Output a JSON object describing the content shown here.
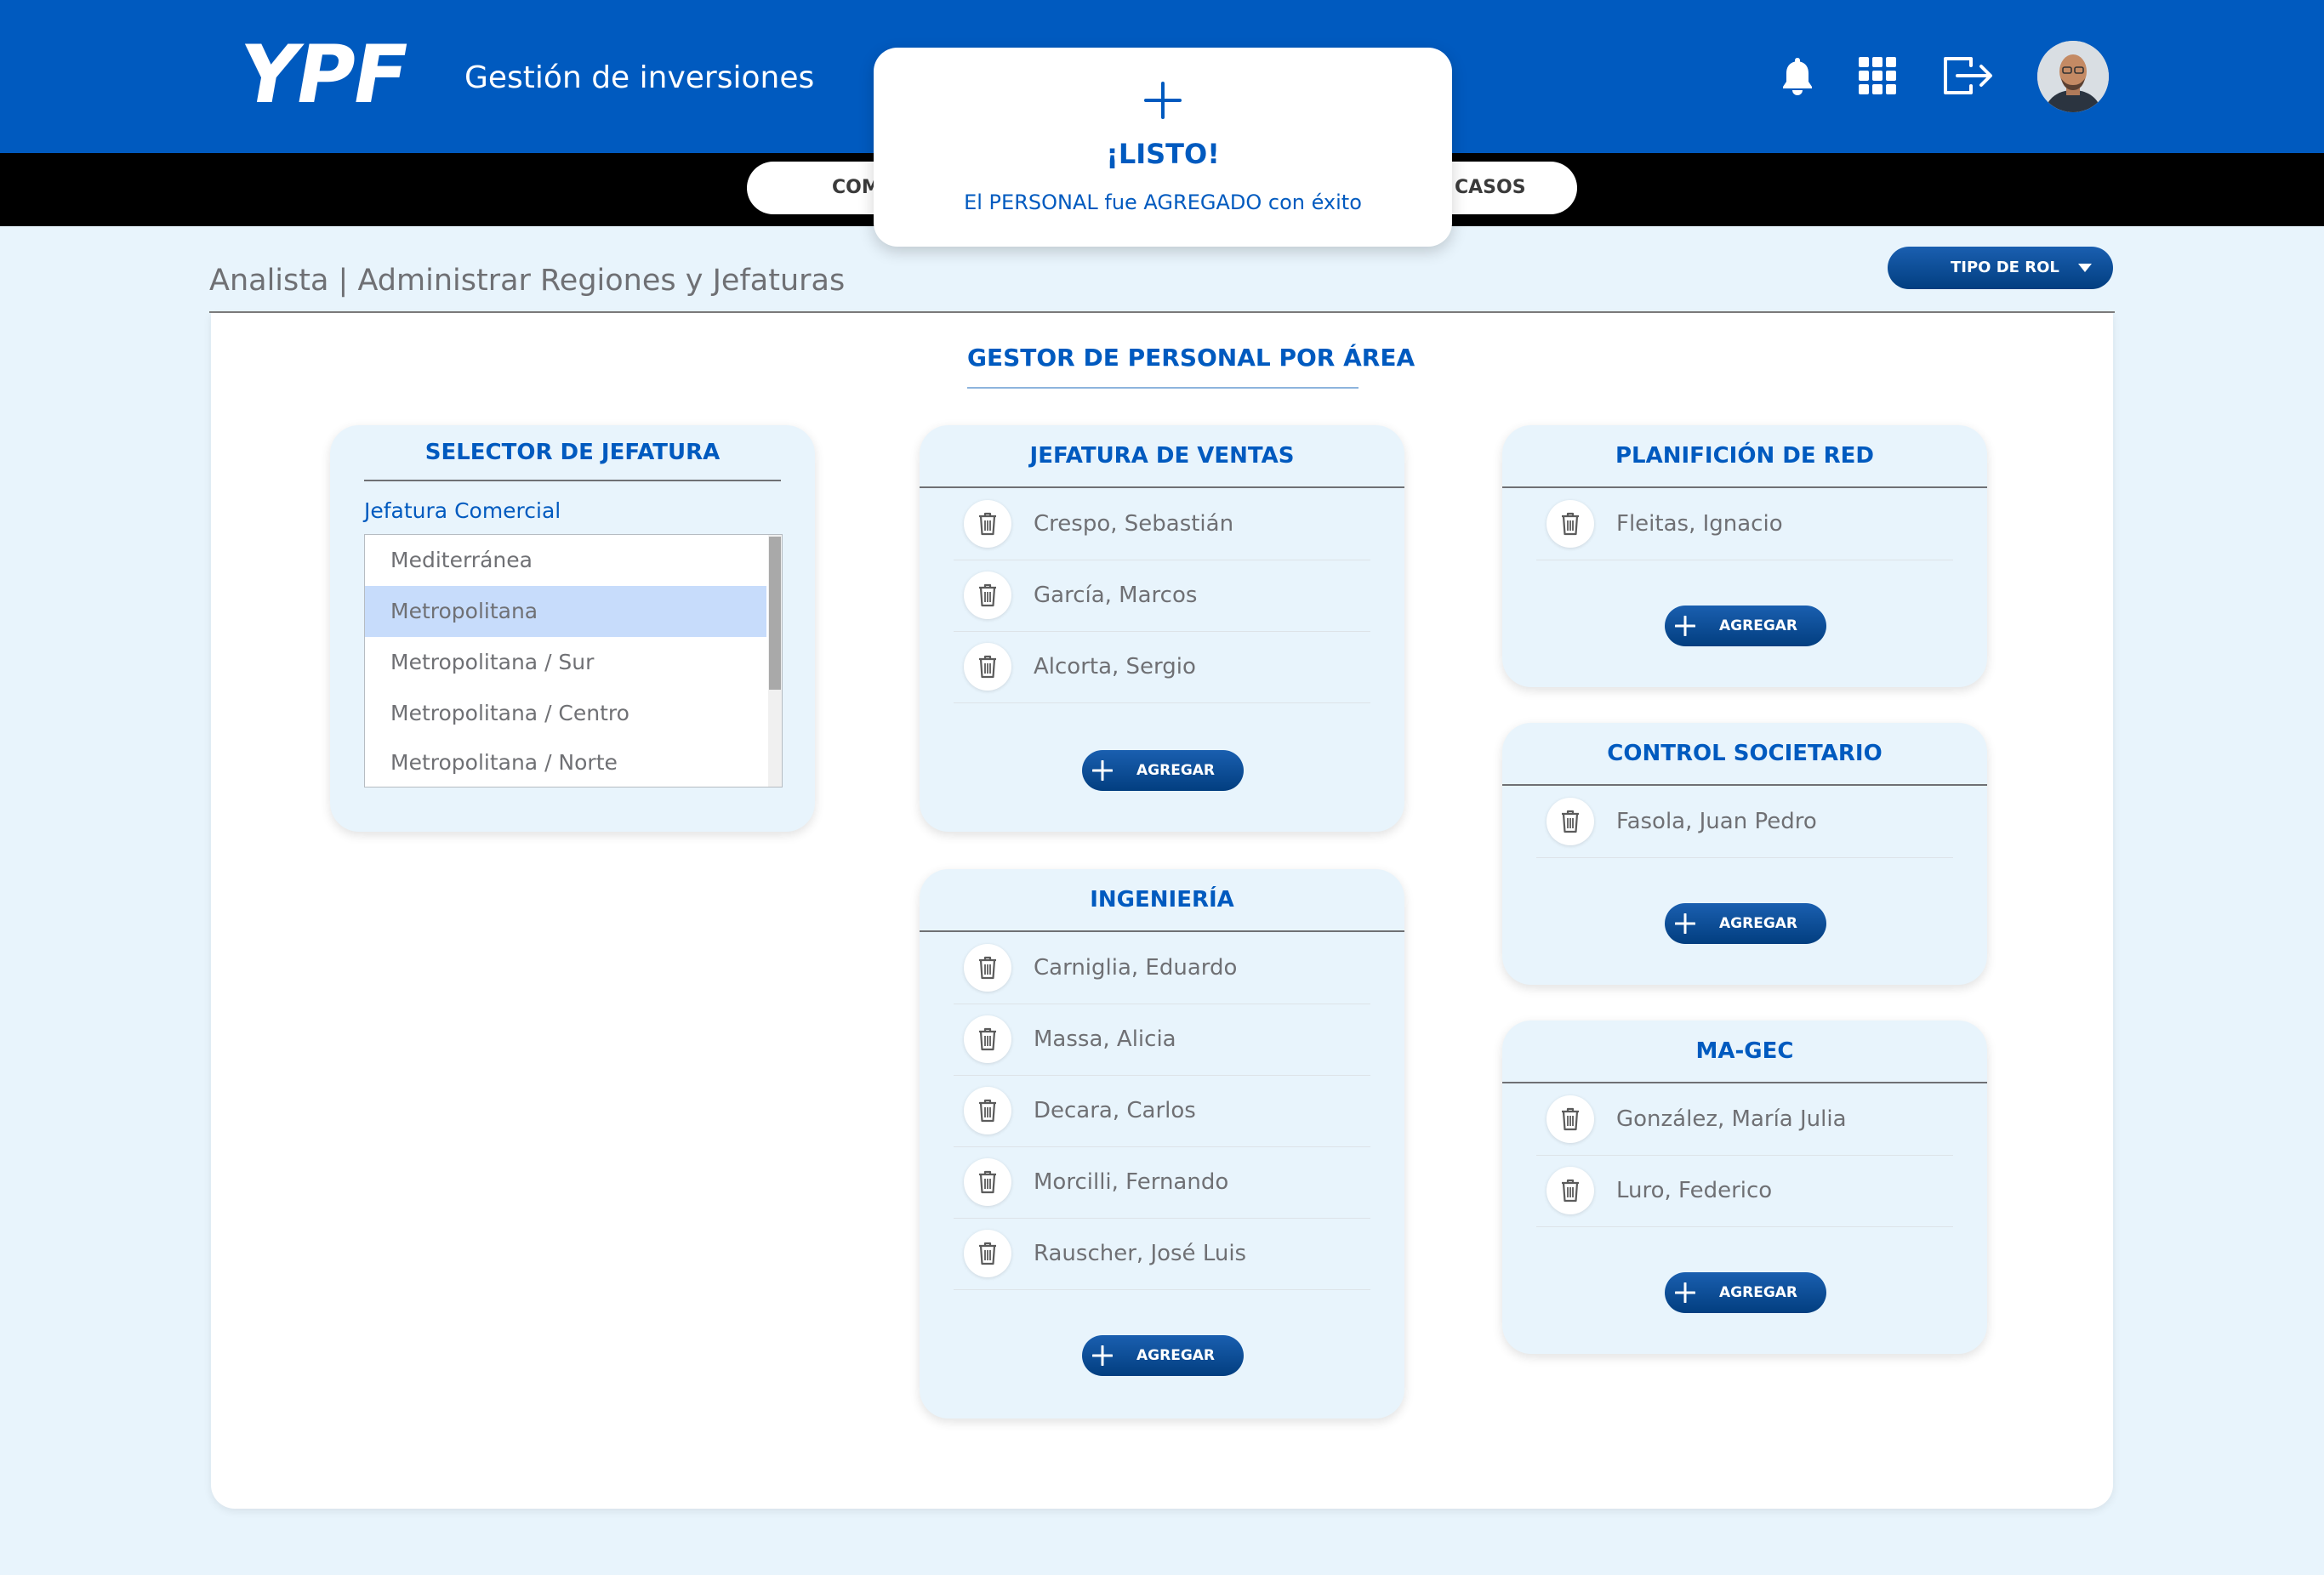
{
  "header": {
    "logo": "YPF",
    "app_title": "Gestión de inversiones"
  },
  "nav": {
    "item_left": "COM",
    "item_right": "CASOS"
  },
  "toast": {
    "title": "¡LISTO!",
    "message": "El PERSONAL fue AGREGADO con éxito"
  },
  "breadcrumb": "Analista | Administrar Regiones y Jefaturas",
  "rol_button": "TIPO DE ROL",
  "main_title": "GESTOR DE PERSONAL POR ÁREA",
  "selector": {
    "title": "SELECTOR DE JEFATURA",
    "label": "Jefatura Comercial",
    "options": [
      "Mediterránea",
      "Metropolitana",
      "Metropolitana / Sur",
      "Metropolitana / Centro",
      "Metropolitana / Norte"
    ],
    "selected": "Metropolitana"
  },
  "add_label": "AGREGAR",
  "cards": {
    "ventas": {
      "title": "JEFATURA DE VENTAS",
      "people": [
        "Crespo, Sebastián",
        "García, Marcos",
        "Alcorta, Sergio"
      ]
    },
    "ingenieria": {
      "title": "INGENIERÍA",
      "people": [
        "Carniglia, Eduardo",
        "Massa, Alicia",
        "Decara, Carlos",
        "Morcilli, Fernando",
        "Rauscher, José Luis"
      ]
    },
    "planificacion": {
      "title": "PLANIFICIÓN DE RED",
      "people": [
        "Fleitas, Ignacio"
      ]
    },
    "control": {
      "title": "CONTROL SOCIETARIO",
      "people": [
        "Fasola, Juan Pedro"
      ]
    },
    "magec": {
      "title": "MA-GEC",
      "people": [
        "González, María Julia",
        "Luro, Federico"
      ]
    }
  },
  "colors": {
    "brand_blue": "#005abf",
    "button_dark": "#023e80",
    "page_bg": "#e8f4fc",
    "selected_option": "#c7dcfb",
    "text_gray": "#6f7074"
  },
  "icons": [
    "bell-icon",
    "apps-grid-icon",
    "logout-icon",
    "plus-icon",
    "trash-icon",
    "caret-down-icon"
  ]
}
